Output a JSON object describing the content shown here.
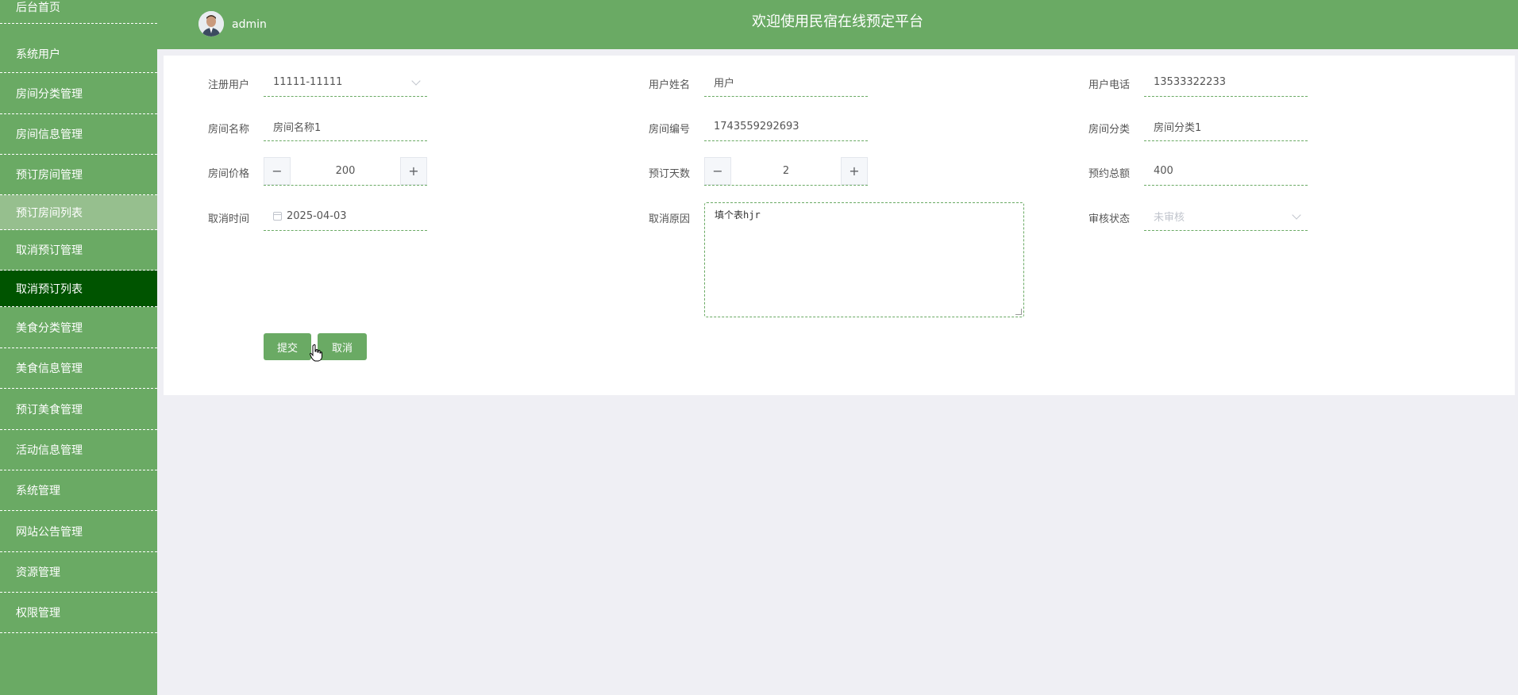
{
  "sidebar": {
    "items": [
      {
        "label": "后台首页"
      },
      {
        "label": "系统用户"
      },
      {
        "label": "房间分类管理"
      },
      {
        "label": "房间信息管理"
      },
      {
        "label": "预订房间管理"
      },
      {
        "label": "预订房间列表"
      },
      {
        "label": "取消预订管理"
      },
      {
        "label": "取消预订列表"
      },
      {
        "label": "美食分类管理"
      },
      {
        "label": "美食信息管理"
      },
      {
        "label": "预订美食管理"
      },
      {
        "label": "活动信息管理"
      },
      {
        "label": "系统管理"
      },
      {
        "label": "网站公告管理"
      },
      {
        "label": "资源管理"
      },
      {
        "label": "权限管理"
      }
    ],
    "hovered_item": "预订房间列表",
    "active_item": "取消预订列表"
  },
  "header": {
    "user": "admin",
    "title": "欢迎使用民宿在线预定平台"
  },
  "form": {
    "registered_user": {
      "label": "注册用户",
      "value": "11111-11111"
    },
    "user_name": {
      "label": "用户姓名",
      "value": "用户"
    },
    "user_phone": {
      "label": "用户电话",
      "value": "13533322233"
    },
    "room_name": {
      "label": "房间名称",
      "value": "房间名称1"
    },
    "room_number": {
      "label": "房间编号",
      "value": "1743559292693"
    },
    "room_category": {
      "label": "房间分类",
      "value": "房间分类1"
    },
    "room_price": {
      "label": "房间价格",
      "value": "200"
    },
    "booking_days": {
      "label": "预订天数",
      "value": "2"
    },
    "booking_total": {
      "label": "预约总额",
      "value": "400"
    },
    "cancel_time": {
      "label": "取消时间",
      "value": "2025-04-03"
    },
    "cancel_reason": {
      "label": "取消原因",
      "value": "填个表hjr"
    },
    "review_status": {
      "label": "审核状态",
      "placeholder": "未审核"
    }
  },
  "buttons": {
    "submit": "提交",
    "cancel": "取消"
  },
  "icons": {
    "stepper_minus": "−",
    "stepper_plus": "+"
  },
  "colors": {
    "primary": "#6aaa64",
    "active": "#005400",
    "hover": "#96bf8e",
    "background": "#efeff4"
  }
}
